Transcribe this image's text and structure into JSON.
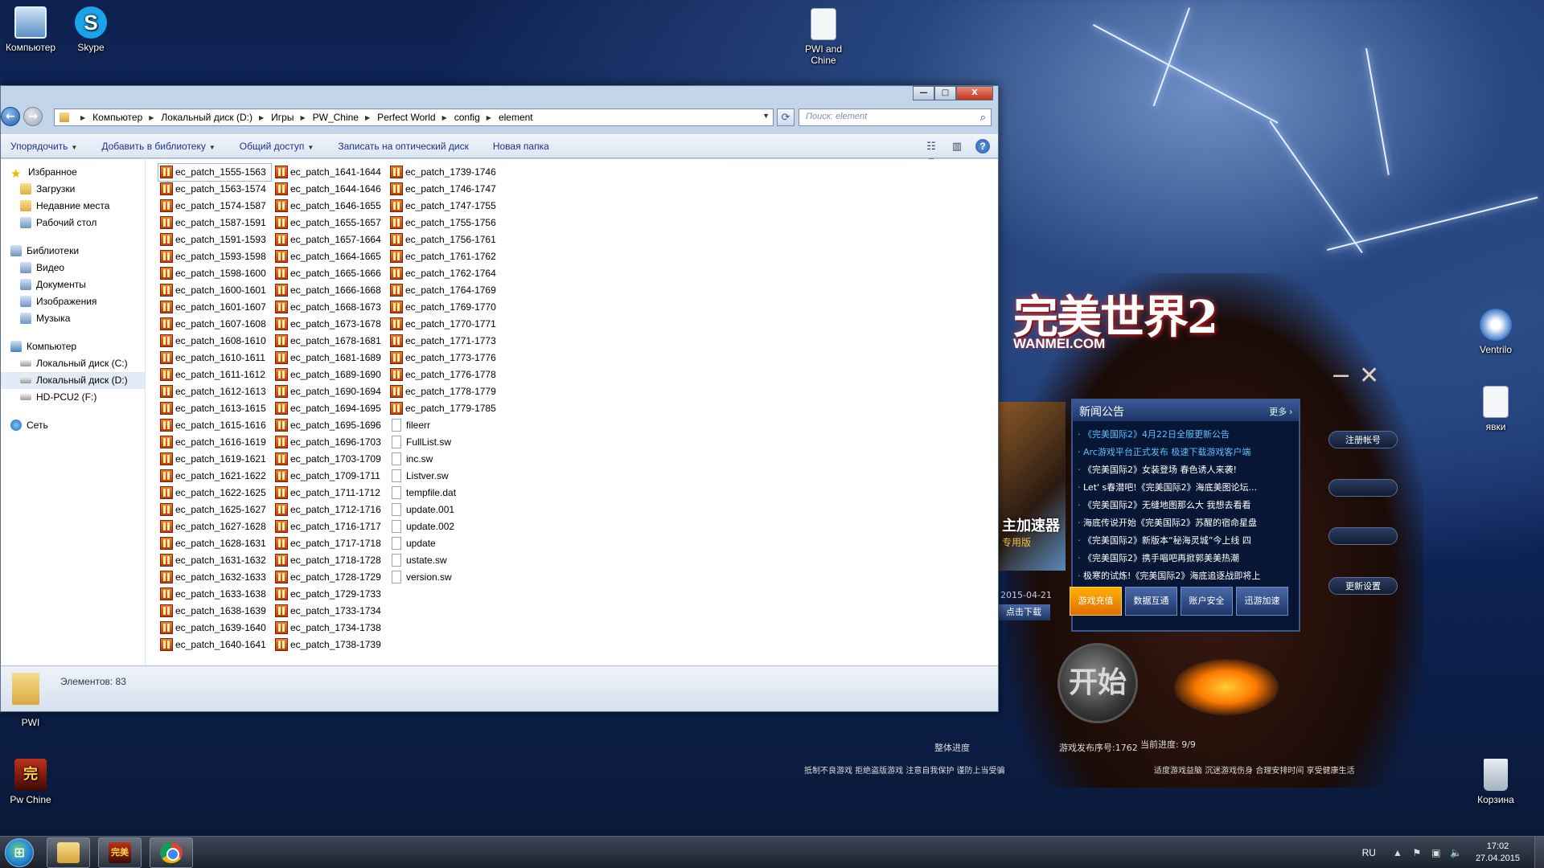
{
  "desktop": {
    "icons": {
      "computer": "Компьютер",
      "skype": "Skype",
      "pwi_chine": "PWI and\nChine",
      "ventrilo": "Ventrilo",
      "yavki": "явки",
      "pwi": "PWI",
      "pw_chine": "Pw Chine",
      "recycle_bin": "Корзина"
    }
  },
  "launcher": {
    "logo": "完美世界2",
    "logo_sub": "WANMEI.COM",
    "news_title": "新闻公告",
    "news_more": "更多",
    "news": [
      "《完美国际2》4月22日全服更新公告",
      "Arc游戏平台正式发布 极速下载游戏客户端",
      "《完美国际2》女装登场 春色诱人来袭!",
      "Let' s春潜吧!《完美国际2》海底美图论坛...",
      "《完美国际2》无缝地图那么大 我想去看看",
      "海底传说开始《完美国际2》苏醒的宿命星盘",
      "《完美国际2》新版本“秘海灵城”今上线 四",
      "《完美国际2》携手唱吧再掀郭美美热潮",
      "极寒的试炼!《完美国际2》海底追逐战即将上"
    ],
    "tabs": [
      "游戏充值",
      "数据互通",
      "账户安全",
      "迅游加速"
    ],
    "side_buttons": [
      "注册帐号",
      "",
      "",
      "更新设置"
    ],
    "left_label": "主加速器",
    "left_sub": "专用版",
    "left_date": "2015-04-21",
    "left_download": "点击下载",
    "start": "开始",
    "overall_progress": "整体进度",
    "release_no": "游戏发布序号:1762",
    "current_progress": "当前进度: 9/9",
    "notice_left": "抵制不良游戏 拒绝盗版游戏 注意自我保护 谨防上当受骗",
    "notice_right": "适度游戏益脑 沉迷游戏伤身 合理安排时间 享受健康生活"
  },
  "explorer": {
    "window_buttons": {
      "minimize": "—",
      "maximize": "□",
      "close": "X"
    },
    "breadcrumb": [
      "Компьютер",
      "Локальный диск (D:)",
      "Игры",
      "PW_Chine",
      "Perfect World",
      "config",
      "element"
    ],
    "search_placeholder": "Поиск: element",
    "toolbar": {
      "organize": "Упорядочить",
      "add_library": "Добавить в библиотеку",
      "share": "Общий доступ",
      "burn": "Записать на оптический диск",
      "new_folder": "Новая папка"
    },
    "nav": {
      "favorites": "Избранное",
      "downloads": "Загрузки",
      "recent": "Недавние места",
      "desktop": "Рабочий стол",
      "libraries": "Библиотеки",
      "video": "Видео",
      "documents": "Документы",
      "images": "Изображения",
      "music": "Музыка",
      "computer": "Компьютер",
      "disk_c": "Локальный диск (C:)",
      "disk_d": "Локальный диск (D:)",
      "disk_f": "HD-PCU2 (F:)",
      "network": "Сеть"
    },
    "files_col1": [
      "ec_patch_1555-1563",
      "ec_patch_1563-1574",
      "ec_patch_1574-1587",
      "ec_patch_1587-1591",
      "ec_patch_1591-1593",
      "ec_patch_1593-1598",
      "ec_patch_1598-1600",
      "ec_patch_1600-1601",
      "ec_patch_1601-1607",
      "ec_patch_1607-1608",
      "ec_patch_1608-1610",
      "ec_patch_1610-1611",
      "ec_patch_1611-1612",
      "ec_patch_1612-1613",
      "ec_patch_1613-1615",
      "ec_patch_1615-1616",
      "ec_patch_1616-1619",
      "ec_patch_1619-1621",
      "ec_patch_1621-1622",
      "ec_patch_1622-1625",
      "ec_patch_1625-1627",
      "ec_patch_1627-1628",
      "ec_patch_1628-1631",
      "ec_patch_1631-1632",
      "ec_patch_1632-1633",
      "ec_patch_1633-1638",
      "ec_patch_1638-1639",
      "ec_patch_1639-1640",
      "ec_patch_1640-1641"
    ],
    "files_col2": [
      "ec_patch_1641-1644",
      "ec_patch_1644-1646",
      "ec_patch_1646-1655",
      "ec_patch_1655-1657",
      "ec_patch_1657-1664",
      "ec_patch_1664-1665",
      "ec_patch_1665-1666",
      "ec_patch_1666-1668",
      "ec_patch_1668-1673",
      "ec_patch_1673-1678",
      "ec_patch_1678-1681",
      "ec_patch_1681-1689",
      "ec_patch_1689-1690",
      "ec_patch_1690-1694",
      "ec_patch_1694-1695",
      "ec_patch_1695-1696",
      "ec_patch_1696-1703",
      "ec_patch_1703-1709",
      "ec_patch_1709-1711",
      "ec_patch_1711-1712",
      "ec_patch_1712-1716",
      "ec_patch_1716-1717",
      "ec_patch_1717-1718",
      "ec_patch_1718-1728",
      "ec_patch_1728-1729",
      "ec_patch_1729-1733",
      "ec_patch_1733-1734",
      "ec_patch_1734-1738",
      "ec_patch_1738-1739"
    ],
    "files_col3": [
      {
        "name": "ec_patch_1739-1746",
        "type": "patch"
      },
      {
        "name": "ec_patch_1746-1747",
        "type": "patch"
      },
      {
        "name": "ec_patch_1747-1755",
        "type": "patch"
      },
      {
        "name": "ec_patch_1755-1756",
        "type": "patch"
      },
      {
        "name": "ec_patch_1756-1761",
        "type": "patch"
      },
      {
        "name": "ec_patch_1761-1762",
        "type": "patch"
      },
      {
        "name": "ec_patch_1762-1764",
        "type": "patch"
      },
      {
        "name": "ec_patch_1764-1769",
        "type": "patch"
      },
      {
        "name": "ec_patch_1769-1770",
        "type": "patch"
      },
      {
        "name": "ec_patch_1770-1771",
        "type": "patch"
      },
      {
        "name": "ec_patch_1771-1773",
        "type": "patch"
      },
      {
        "name": "ec_patch_1773-1776",
        "type": "patch"
      },
      {
        "name": "ec_patch_1776-1778",
        "type": "patch"
      },
      {
        "name": "ec_patch_1778-1779",
        "type": "patch"
      },
      {
        "name": "ec_patch_1779-1785",
        "type": "patch"
      },
      {
        "name": "fileerr",
        "type": "doc"
      },
      {
        "name": "FullList.sw",
        "type": "doc"
      },
      {
        "name": "inc.sw",
        "type": "doc"
      },
      {
        "name": "Listver.sw",
        "type": "doc"
      },
      {
        "name": "tempfile.dat",
        "type": "doc"
      },
      {
        "name": "update.001",
        "type": "doc"
      },
      {
        "name": "update.002",
        "type": "doc"
      },
      {
        "name": "update",
        "type": "doc"
      },
      {
        "name": "ustate.sw",
        "type": "doc"
      },
      {
        "name": "version.sw",
        "type": "doc"
      }
    ],
    "status": "Элементов: 83"
  },
  "taskbar": {
    "game_app": "完美国际",
    "lang": "RU",
    "time": "17:02",
    "date": "27.04.2015"
  }
}
